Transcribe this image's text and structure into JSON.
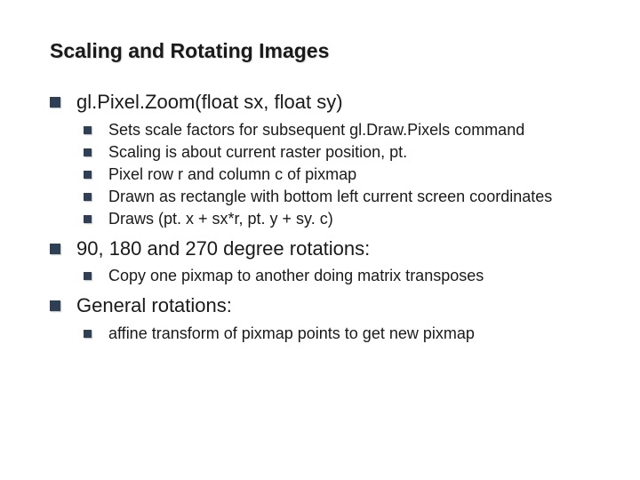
{
  "title": "Scaling and Rotating Images",
  "bullets": [
    {
      "text": "gl.Pixel.Zoom(float sx, float sy)",
      "sub": [
        "Sets scale factors for subsequent gl.Draw.Pixels command",
        "Scaling is about current raster position, pt.",
        "Pixel row r and column c of pixmap",
        "Drawn as rectangle with bottom left current screen coordinates",
        "Draws (pt. x + sx*r, pt. y + sy. c)"
      ]
    },
    {
      "text": "90, 180 and 270 degree rotations:",
      "sub": [
        "Copy one pixmap to another doing matrix transposes"
      ]
    },
    {
      "text": "General rotations:",
      "sub": [
        "affine transform of pixmap points to get new pixmap"
      ]
    }
  ]
}
